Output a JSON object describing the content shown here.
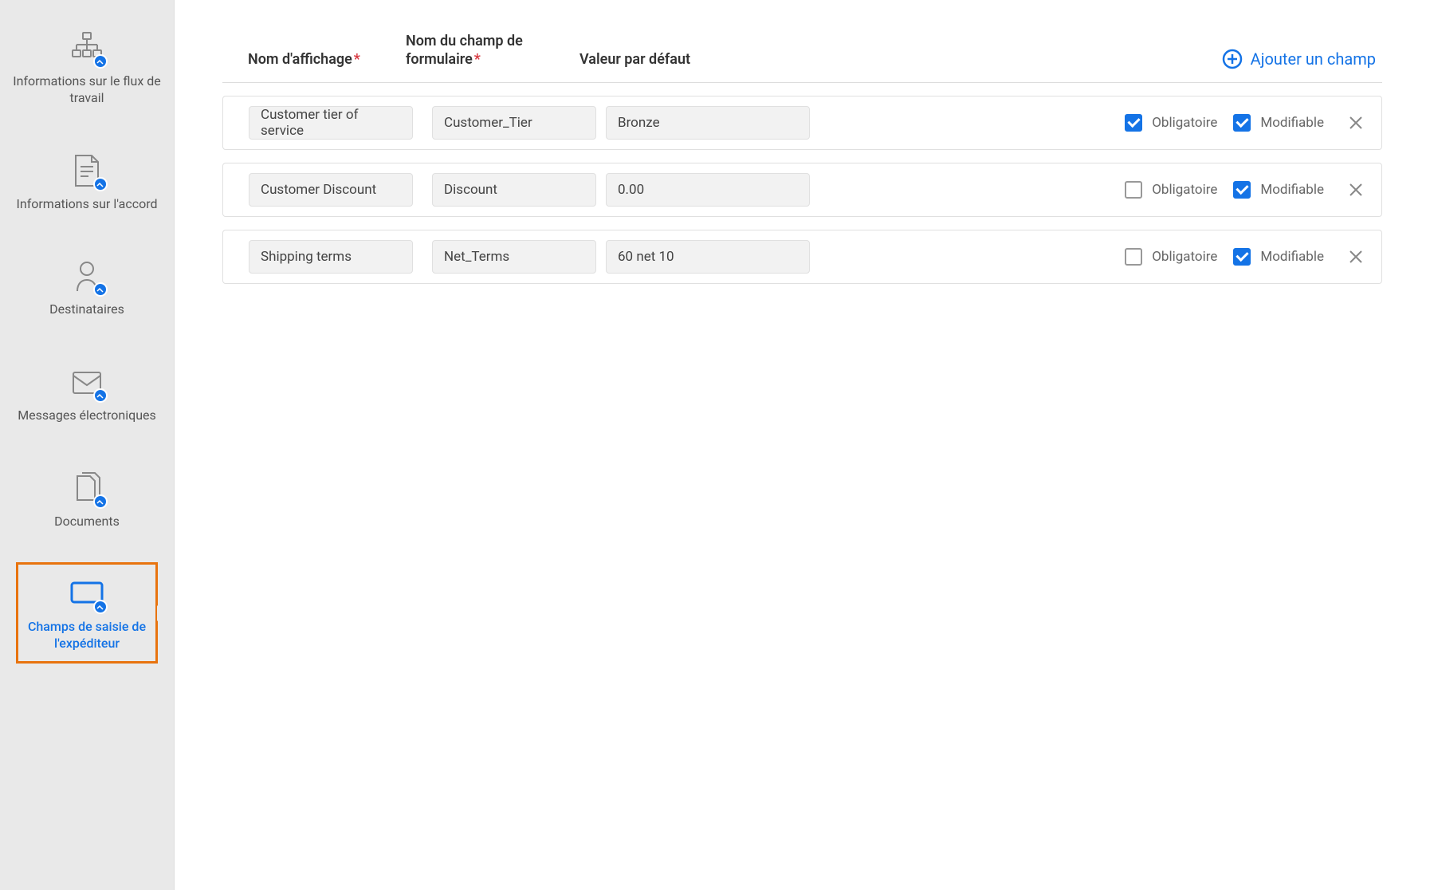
{
  "sidebar": {
    "items": [
      {
        "label": "Informations sur le flux de travail",
        "icon": "workflow"
      },
      {
        "label": "Informations sur l'accord",
        "icon": "agreement"
      },
      {
        "label": "Destinataires",
        "icon": "recipients"
      },
      {
        "label": "Messages électroniques",
        "icon": "email"
      },
      {
        "label": "Documents",
        "icon": "documents"
      },
      {
        "label": "Champs de saisie de l'expéditeur",
        "icon": "sender-fields",
        "active": true
      }
    ]
  },
  "headers": {
    "display_name": "Nom d'affichage",
    "form_field_name": "Nom du champ de formulaire",
    "default_value": "Valeur par défaut"
  },
  "add_field_label": "Ajouter un champ",
  "cb_labels": {
    "required": "Obligatoire",
    "editable": "Modifiable"
  },
  "fields": [
    {
      "display_name": "Customer tier of service",
      "form_name": "Customer_Tier",
      "default": "Bronze",
      "required": true,
      "editable": true
    },
    {
      "display_name": "Customer Discount",
      "form_name": "Discount",
      "default": "0.00",
      "required": false,
      "editable": true
    },
    {
      "display_name": "Shipping terms",
      "form_name": "Net_Terms",
      "default": "60 net 10",
      "required": false,
      "editable": true
    }
  ]
}
